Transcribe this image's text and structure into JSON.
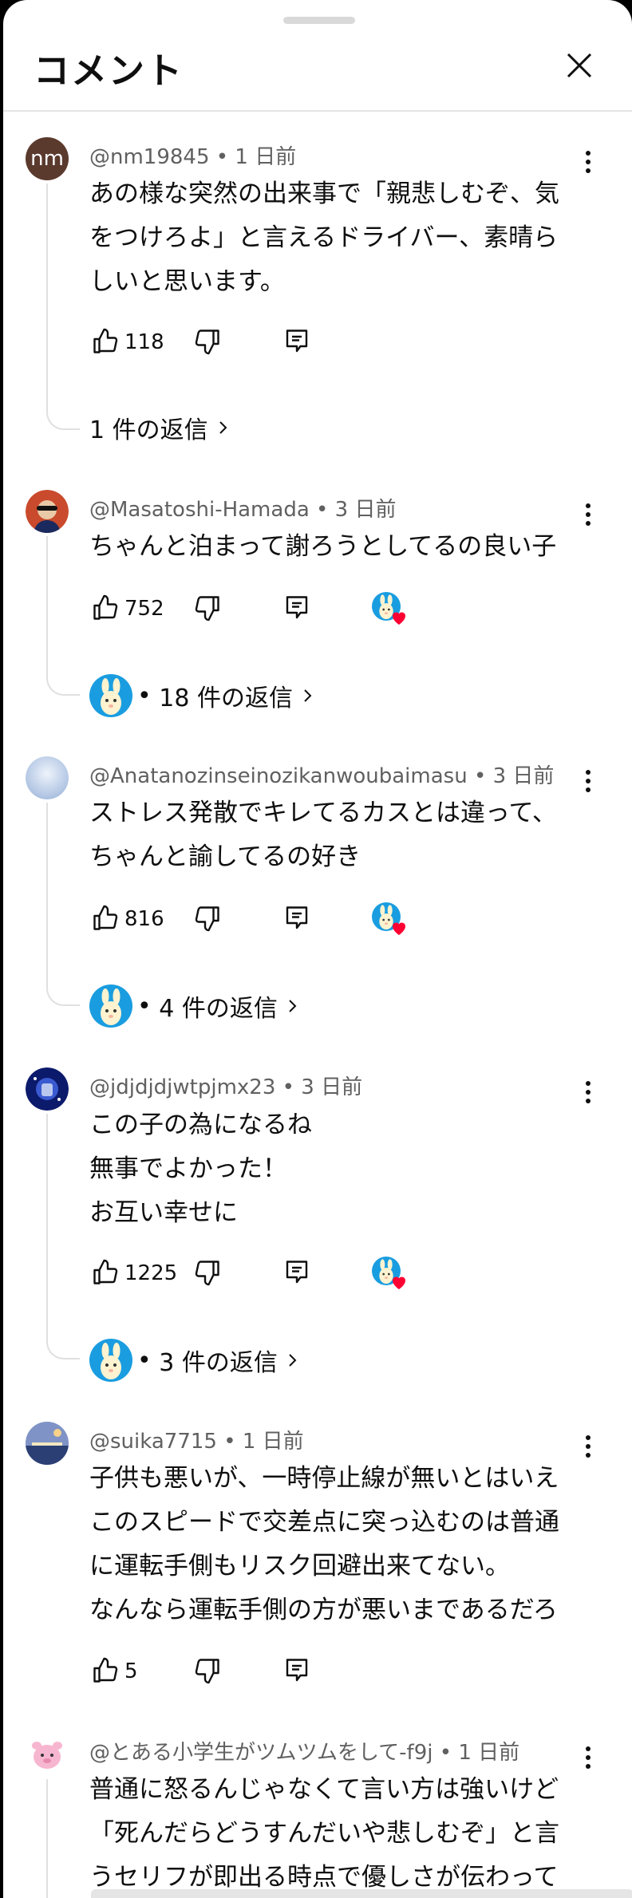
{
  "header": {
    "title": "コメント"
  },
  "comments": [
    {
      "handle": "@nm19845",
      "time": "1 日前",
      "avatar_text": "nm",
      "lines": [
        "あの様な突然の出来事で「親悲しむぞ、気",
        "をつけろよ」と言えるドライバー、素晴ら",
        "しいと思います。"
      ],
      "likes": "118",
      "replies_label": "1 件の返信"
    },
    {
      "handle": "@Masatoshi-Hamada",
      "time": "3 日前",
      "lines": [
        "ちゃんと泊まって謝ろうとしてるの良い子"
      ],
      "likes": "752",
      "replies_label": "18 件の返信"
    },
    {
      "handle": "@Anatanozinseinozikanwoubaimasu",
      "time": "3 日前",
      "lines": [
        "ストレス発散でキレてるカスとは違って、",
        "ちゃんと諭してるの好き"
      ],
      "likes": "816",
      "replies_label": "4 件の返信"
    },
    {
      "handle": "@jdjdjdjwtpjmx23",
      "time": "3 日前",
      "lines": [
        "この子の為になるね",
        "無事でよかった！",
        "お互い幸せに"
      ],
      "likes": "1225",
      "replies_label": "3 件の返信"
    },
    {
      "handle": "@suika7715",
      "time": "1 日前",
      "lines": [
        "子供も悪いが、一時停止線が無いとはいえ",
        "このスピードで交差点に突っ込むのは普通",
        "に運転手側もリスク回避出来てない。",
        "なんなら運転手側の方が悪いまであるだろ"
      ],
      "likes": "5"
    },
    {
      "handle": "@とある小学生がツムツムをして-f9j",
      "time": "1 日前",
      "lines": [
        "普通に怒るんじゃなくて言い方は強いけど",
        "「死んだらどうすんだいや悲しむぞ」と言",
        "うセリフが即出る時点で優しさが伝わって"
      ]
    }
  ],
  "colors": {
    "text": "#0f0f0f",
    "meta": "#606060",
    "heart": "#ff0033",
    "divider": "#e5e5e5",
    "bunny_bg": "#1a9de0"
  },
  "icons": [
    "close-icon",
    "kebab-icon",
    "thumb-up-icon",
    "thumb-down-icon",
    "reply-icon",
    "heart-icon",
    "chevron-right-icon"
  ]
}
